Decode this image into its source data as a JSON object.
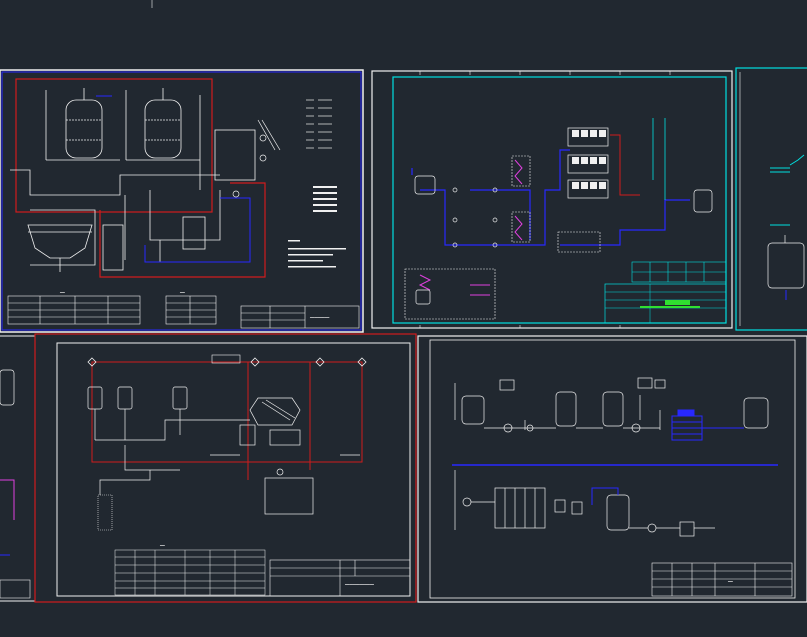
{
  "drawing_set": {
    "sheet1": {
      "bar_a": "━━",
      "bar_b": "━━━━━━━━"
    },
    "sheet4": {
      "notes_title": "━━━━━━━━",
      "title_text": "━━━━━━━━━━━━"
    },
    "colors": {
      "background": "#212830",
      "line_white": "#f0f0f0",
      "line_red": "#d01c1c",
      "line_blue": "#2828ff",
      "line_cyan": "#00e0e0",
      "line_magenta": "#e040e0",
      "line_green": "#30e030"
    }
  }
}
